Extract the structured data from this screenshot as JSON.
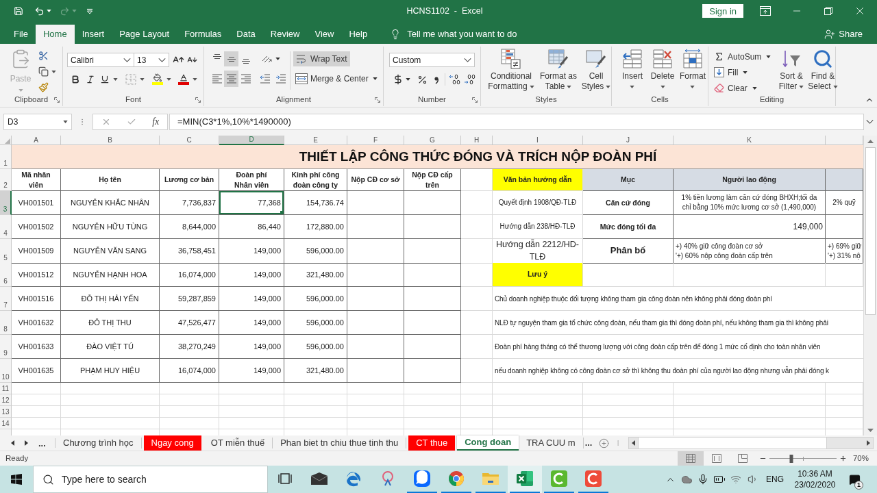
{
  "window": {
    "title": "HCNS1102  -  Excel",
    "sign_in": "Sign in"
  },
  "ribbon_tabs": [
    {
      "label": "File",
      "selected": false
    },
    {
      "label": "Home",
      "selected": true
    },
    {
      "label": "Insert",
      "selected": false
    },
    {
      "label": "Page Layout",
      "selected": false
    },
    {
      "label": "Formulas",
      "selected": false
    },
    {
      "label": "Data",
      "selected": false
    },
    {
      "label": "Review",
      "selected": false
    },
    {
      "label": "View",
      "selected": false
    },
    {
      "label": "Help",
      "selected": false
    }
  ],
  "tell_me": {
    "placeholder": "Tell me what you want to do"
  },
  "share": "Share",
  "ribbon": {
    "clipboard": {
      "paste": {
        "label": "Paste",
        "disabled": true
      },
      "label": "Clipboard"
    },
    "font": {
      "name": "Calibri",
      "size": "13",
      "label": "Font"
    },
    "alignment": {
      "vertical_align": [
        {
          "selected": false
        },
        {
          "selected": true
        },
        {
          "selected": false
        }
      ],
      "horizontal_align": [
        {
          "selected": false
        },
        {
          "selected": true
        },
        {
          "selected": false
        }
      ],
      "wrap_text": {
        "label": "Wrap Text",
        "on": true
      },
      "merge": "Merge & Center",
      "label": "Alignment"
    },
    "number": {
      "format": "Custom",
      "label": "Number"
    },
    "styles": {
      "buttons": [
        {
          "lines": [
            "Conditional",
            "Formatting"
          ]
        },
        {
          "lines": [
            "Format as",
            "Table"
          ]
        },
        {
          "lines": [
            "Cell",
            "Styles"
          ]
        }
      ],
      "label": "Styles"
    },
    "cells": {
      "buttons": [
        "Insert",
        "Delete",
        "Format"
      ],
      "label": "Cells"
    },
    "editing": {
      "small": [
        "AutoSum",
        "Fill",
        "Clear"
      ],
      "big": [
        {
          "lines": [
            "Sort &",
            "Filter"
          ]
        },
        {
          "lines": [
            "Find &",
            "Select"
          ]
        }
      ],
      "label": "Editing"
    }
  },
  "formula_bar": {
    "name_box": "D3",
    "function_label": "fx",
    "formula": "=MIN(C3*1%,10%*1490000)"
  },
  "sheet": {
    "columns": [
      {
        "label": "A",
        "selected": false
      },
      {
        "label": "B",
        "selected": false
      },
      {
        "label": "C",
        "selected": false
      },
      {
        "label": "D",
        "selected": true
      },
      {
        "label": "E",
        "selected": false
      },
      {
        "label": "F",
        "selected": false
      },
      {
        "label": "G",
        "selected": false
      },
      {
        "label": "H",
        "selected": false
      },
      {
        "label": "I",
        "selected": false
      },
      {
        "label": "J",
        "selected": false
      },
      {
        "label": "K",
        "selected": false
      }
    ],
    "row_headers": [
      {
        "label": "1",
        "selected": false
      },
      {
        "label": "2",
        "selected": false
      },
      {
        "label": "3",
        "selected": true
      },
      {
        "label": "4",
        "selected": false
      },
      {
        "label": "5",
        "selected": false
      },
      {
        "label": "6",
        "selected": false
      },
      {
        "label": "7",
        "selected": false
      },
      {
        "label": "8",
        "selected": false
      },
      {
        "label": "9",
        "selected": false
      },
      {
        "label": "10",
        "selected": false
      },
      {
        "label": "11",
        "selected": false
      },
      {
        "label": "12",
        "selected": false
      },
      {
        "label": "13",
        "selected": false
      },
      {
        "label": "14",
        "selected": false
      }
    ],
    "title": "THIẾT LẬP CÔNG THỨC ĐÓNG VÀ TRÍCH NỘP ĐOÀN PHÍ",
    "table": {
      "headers": [
        {
          "lines": [
            "Mã nhân",
            "viên"
          ]
        },
        {
          "lines": [
            "Họ tên"
          ]
        },
        {
          "lines": [
            "Lương cơ bản"
          ]
        },
        {
          "lines": [
            "Đoàn phí",
            "Nhân viên"
          ]
        },
        {
          "lines": [
            "Kinh phí công",
            "đoàn công ty"
          ]
        },
        {
          "lines": [
            "Nộp CĐ cơ sở"
          ]
        },
        {
          "lines": [
            "Nộp CĐ cấp",
            "trên"
          ]
        }
      ],
      "rows": [
        [
          "VH001501",
          "NGUYỄN KHẮC NHÂN",
          "7,736,837",
          "77,368",
          "154,736.74"
        ],
        [
          "VH001502",
          "NGUYỄN HỮU TÙNG",
          "8,644,000",
          "86,440",
          "172,880.00"
        ],
        [
          "VH001509",
          "NGUYỄN VĂN SANG",
          "36,758,451",
          "149,000",
          "596,000.00"
        ],
        [
          "VH001512",
          "NGUYỄN HẠNH HOA",
          "16,074,000",
          "149,000",
          "321,480.00"
        ],
        [
          "VH001516",
          "ĐỖ THỊ HẢI YẾN",
          "59,287,859",
          "149,000",
          "596,000.00"
        ],
        [
          "VH001632",
          "ĐỖ THỊ THU",
          "47,526,477",
          "149,000",
          "596,000.00"
        ],
        [
          "VH001633",
          "ĐÀO VIỆT TÚ",
          "38,270,249",
          "149,000",
          "596,000.00"
        ],
        [
          "VH001635",
          "PHẠM HUY HIỆU",
          "16,074,000",
          "149,000",
          "321,480.00"
        ]
      ]
    },
    "guide": {
      "headers": [
        {
          "label": "Văn bản hướng dẫn",
          "color": "#ffff00"
        },
        {
          "label": "Mục",
          "color": "#d6dce4"
        },
        {
          "label": "Người lao động",
          "color": "#d6dce4"
        },
        {
          "color": "#d6dce4"
        }
      ],
      "rows": [
        {
          "cells": [
            {
              "kind": "text",
              "lines": [
                "Quyết định 1908/QĐ-TLĐ"
              ]
            },
            {
              "kind": "label",
              "lines": [
                "Căn cứ đóng"
              ]
            },
            {
              "kind": "text",
              "lines": [
                "1% tiền lương làm căn cứ đóng BHXH;tối đa",
                "chỉ bằng 10% mức lương cơ sở (1,490,000)"
              ]
            },
            {
              "kind": "text",
              "lines": [
                "2% quỹ"
              ]
            }
          ]
        },
        {
          "cells": [
            {
              "kind": "text",
              "lines": [
                "Hướng dẫn 238/HĐ-TLĐ"
              ]
            },
            {
              "kind": "label",
              "lines": [
                "Mức đóng tối đa"
              ]
            },
            {
              "kind": "number",
              "lines": [
                "149,000"
              ]
            },
            null
          ]
        },
        {
          "cells": [
            {
              "kind": "text_large",
              "lines": [
                "Hướng dẫn 2212/HD-",
                "TLĐ"
              ]
            },
            {
              "kind": "label_large",
              "lines": [
                "Phân bổ"
              ]
            },
            {
              "kind": "list",
              "lines": [
                "+) 40% giữ công đoàn cơ sở",
                "'+) 60% nộp công đoàn cấp trên"
              ]
            },
            {
              "kind": "list",
              "lines": [
                "+) 69% giữ",
                "'+) 31% nộ"
              ]
            }
          ]
        }
      ],
      "note_label": {
        "label": "Lưu ý",
        "color": "#ffff00"
      },
      "notes": [
        "Chủ doanh nghiệp thuộc đối tượng không tham gia công đoàn nên không phải đóng đoàn phí",
        "NLĐ tự nguyện tham gia tổ chức công đoàn, nếu tham gia thì đóng đoàn phí, nếu không tham gia thì không phải",
        "Đoàn phí hàng tháng có thể thương lượng với công đoàn cấp trên để đóng 1 mức cố định cho toàn nhân viên",
        "nếu doanh nghiệp không có công đoàn cơ sở thì không thu đoàn phí của người lao động nhưng vẫn phải đóng k"
      ]
    }
  },
  "sheet_tabs": {
    "more_left": "...",
    "tabs": [
      {
        "label": "Chương trình học",
        "selected": false
      },
      {
        "label": "Ngay cong",
        "selected": false,
        "color": "#ff0000"
      },
      {
        "label": "OT miễn thuế",
        "selected": false
      },
      {
        "label": "Phan biet tn chiu thue tinh thu",
        "selected": false
      },
      {
        "label": "CT thue",
        "selected": false,
        "color": "#ff0000"
      },
      {
        "label": "Cong doan",
        "selected": true
      },
      {
        "label": "TRA CUU m",
        "selected": false
      }
    ],
    "more_right": "..."
  },
  "status_bar": {
    "status": "Ready",
    "views": [
      {
        "selected": true
      },
      {
        "selected": false
      },
      {
        "selected": false
      }
    ],
    "zoom": {
      "level": 0.33,
      "label": "70%"
    }
  },
  "taskbar": {
    "search": {
      "placeholder": "Type here to search"
    },
    "apps": [
      {
        "running": false,
        "active": false
      },
      {
        "running": false,
        "active": false
      },
      {
        "running": false,
        "active": false
      },
      {
        "running": false,
        "active": false
      },
      {
        "running": true,
        "active": false
      },
      {
        "running": true,
        "active": false
      },
      {
        "running": true,
        "active": false
      },
      {
        "running": true,
        "active": true
      },
      {
        "running": true,
        "active": false
      },
      {
        "running": true,
        "active": false
      }
    ],
    "language": "ENG",
    "time": "10:36 AM",
    "date": "23/02/2020",
    "notifications": "1"
  }
}
